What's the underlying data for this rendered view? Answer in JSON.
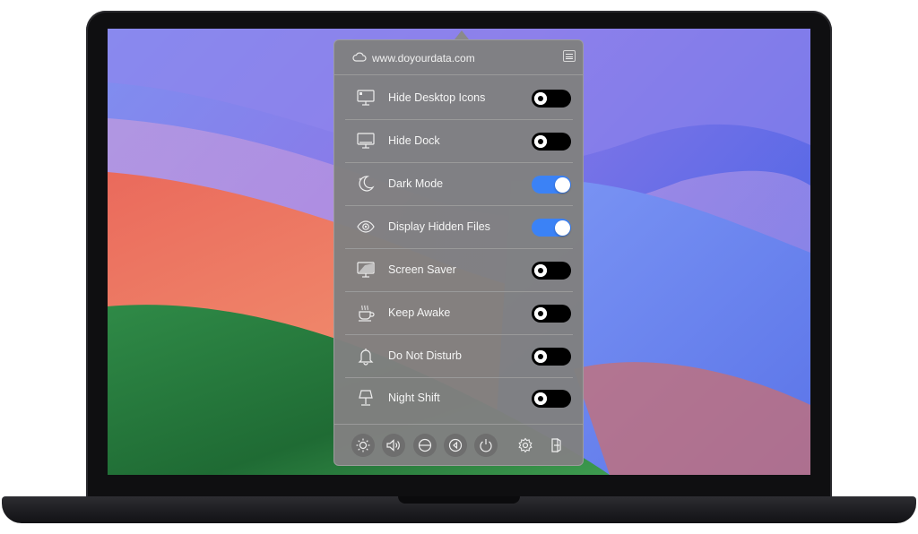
{
  "header": {
    "site_label": "www.doyourdata.com"
  },
  "toggles": [
    {
      "label": "Hide Desktop Icons",
      "icon": "desktop-icon",
      "state": "off"
    },
    {
      "label": "Hide Dock",
      "icon": "dock-icon",
      "state": "off"
    },
    {
      "label": "Dark Mode",
      "icon": "moon-icon",
      "state": "on"
    },
    {
      "label": "Display Hidden Files",
      "icon": "eye-icon",
      "state": "on"
    },
    {
      "label": "Screen Saver",
      "icon": "screen-saver-icon",
      "state": "off"
    },
    {
      "label": "Keep Awake",
      "icon": "coffee-cup-icon",
      "state": "off"
    },
    {
      "label": "Do Not Disturb",
      "icon": "bell-icon",
      "state": "off"
    },
    {
      "label": "Night Shift",
      "icon": "lamp-icon",
      "state": "off"
    }
  ],
  "footer_buttons": [
    "brightness-icon",
    "volume-icon",
    "sleep-display-icon",
    "eject-icon",
    "power-icon",
    "settings-icon",
    "quit-icon"
  ],
  "colors": {
    "toggle_on": "#3b82f6",
    "toggle_off": "#000000",
    "panel": "#808080"
  }
}
